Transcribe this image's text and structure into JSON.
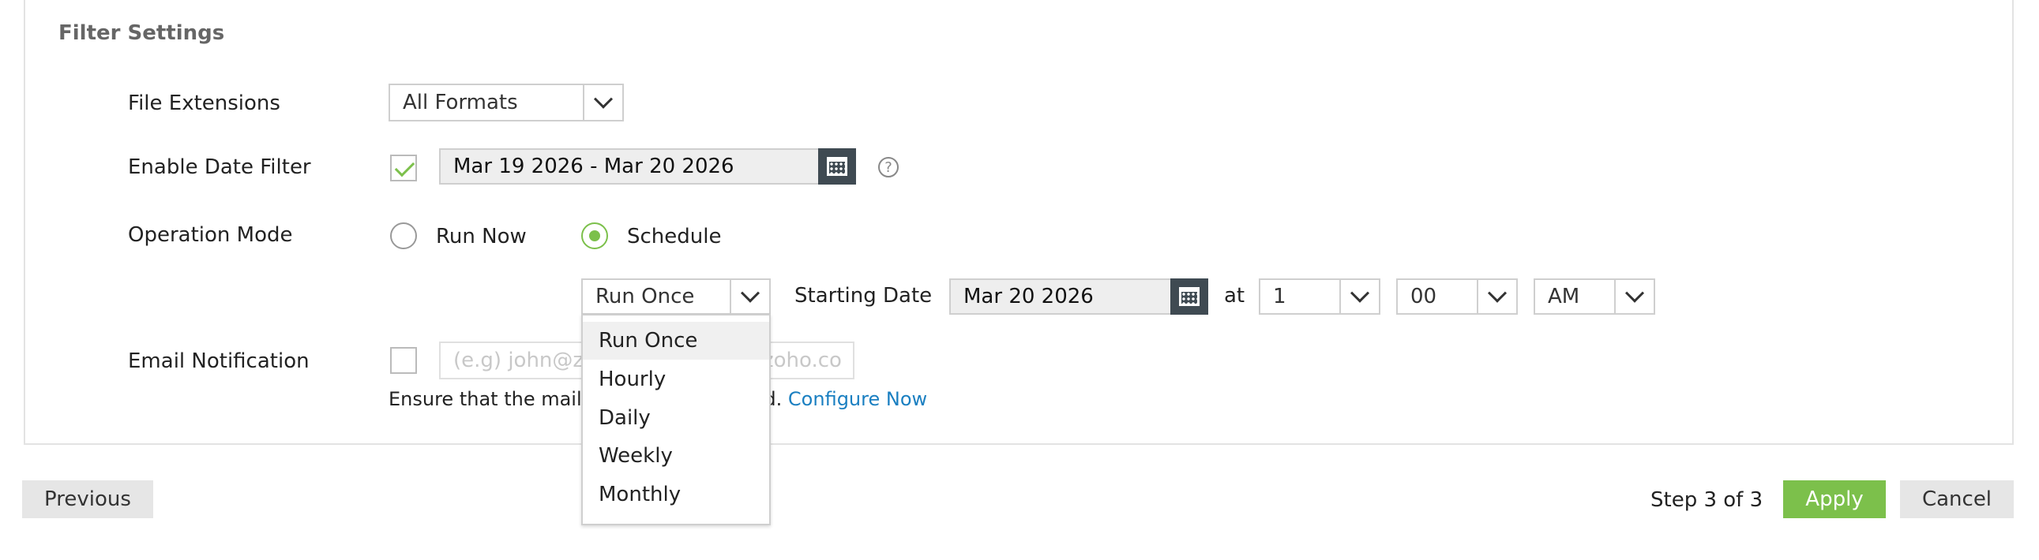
{
  "section_title": "Filter Settings",
  "file_extensions": {
    "label": "File Extensions",
    "selected": "All Formats"
  },
  "date_filter": {
    "label": "Enable Date Filter",
    "checked": true,
    "range": "Mar 19 2026 - Mar 20 2026",
    "help_symbol": "?"
  },
  "operation_mode": {
    "label": "Operation Mode",
    "options": [
      "Run Now",
      "Schedule"
    ],
    "selected": "Schedule"
  },
  "schedule": {
    "frequency": "Run Once",
    "starting_date_label": "Starting Date",
    "starting_date": "Mar 20 2026",
    "at_label": "at",
    "hour": "1",
    "minute": "00",
    "ampm": "AM"
  },
  "frequency_dropdown": {
    "options": [
      "Run Once",
      "Hourly",
      "Daily",
      "Weekly",
      "Monthly"
    ],
    "highlighted": "Run Once"
  },
  "email_notification": {
    "label": "Email Notification",
    "checked": false,
    "placeholder": "(e.g) john@zoho.com, smith@zoho.co",
    "note_before": "Ensure that the mail server is configured.",
    "note_link": "Configure Now"
  },
  "footer": {
    "previous": "Previous",
    "step_text": "Step 3 of 3",
    "apply": "Apply",
    "cancel": "Cancel"
  },
  "colors": {
    "accent_green": "#7cc04b",
    "link_blue": "#1a7fc1",
    "calendar_button": "#3f4a52"
  },
  "icons": {
    "calendar": "calendar-icon",
    "help": "help-icon",
    "dropdown": "chevron-down-icon",
    "check": "checkmark-icon"
  }
}
